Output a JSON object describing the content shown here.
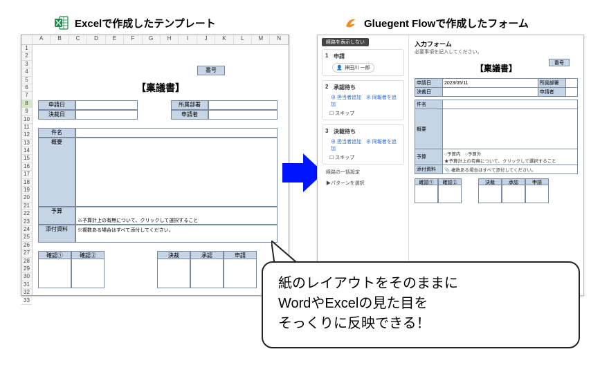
{
  "headings": {
    "excel": "Excelで作成したテンプレート",
    "gluegent": "Gluegent Flowで作成したフォーム"
  },
  "excel": {
    "columns": [
      "A",
      "B",
      "C",
      "D",
      "E",
      "F",
      "G",
      "H",
      "I",
      "J",
      "K",
      "L",
      "M",
      "N"
    ],
    "rows": [
      "1",
      "2",
      "3",
      "4",
      "5",
      "6",
      "7",
      "8",
      "9",
      "10",
      "11",
      "12",
      "13",
      "14",
      "15",
      "16",
      "17",
      "18",
      "19",
      "20",
      "21",
      "22",
      "23",
      "24",
      "25",
      "26",
      "27",
      "28",
      "29",
      "30",
      "31",
      "32",
      "33"
    ],
    "selected_row": "8",
    "number_label": "番号",
    "title": "【稟議書】",
    "fields": {
      "app_date": "申請日",
      "dec_date": "決裁日",
      "dept": "所属部署",
      "applicant": "申請者",
      "subject": "件名",
      "outline": "概要",
      "budget": "予算",
      "budget_note": "※予算計上の有無について、クリックして選択すること",
      "attach": "添付資料",
      "attach_note": "※複数ある場合はすべて添付してください。"
    },
    "stamps_left": [
      "確認①",
      "確認②"
    ],
    "stamps_right": [
      "決裁",
      "承認",
      "申請"
    ]
  },
  "gluegent": {
    "sidebar": {
      "tag": "経路を表示しない",
      "step1": {
        "num": "1",
        "title": "申請",
        "person": "神田川 一郎"
      },
      "step2": {
        "num": "2",
        "title": "承認待ち",
        "link_add": "担当者追加",
        "link_same": "同報者を追加",
        "skip": "スキップ"
      },
      "step3": {
        "num": "3",
        "title": "決裁待ち",
        "link_add": "担当者追加",
        "link_same": "同報者を追加",
        "skip": "スキップ"
      },
      "flow_note1": "経路の一括設定",
      "flow_note2": "▶パターンを選択"
    },
    "main": {
      "heading": "入力フォーム",
      "sub": "必要事項を記入してください。",
      "number_label": "番号",
      "title": "【稟議書】",
      "app_date": "申請日",
      "app_date_value": "2023/05/11",
      "dec_date": "決裁日",
      "dept": "所属部署",
      "applicant": "申請者",
      "subject": "件名",
      "outline": "概要",
      "budget": "予算",
      "budget_opt_in": "予算内",
      "budget_opt_out": "予算外",
      "budget_note": "★予算計上の有無について、クリックして選択すること",
      "attach": "添付資料",
      "attach_note": "複数ある場合はすべて添付してください。",
      "stamps_left": [
        "確認①",
        "確認②"
      ],
      "stamps_right": [
        "決裁",
        "承認",
        "申請"
      ]
    }
  },
  "bubble": {
    "line1": "紙のレイアウトをそのままに",
    "line2": "WordやExcelの見た目を",
    "line3": "そっくりに反映できる！"
  }
}
